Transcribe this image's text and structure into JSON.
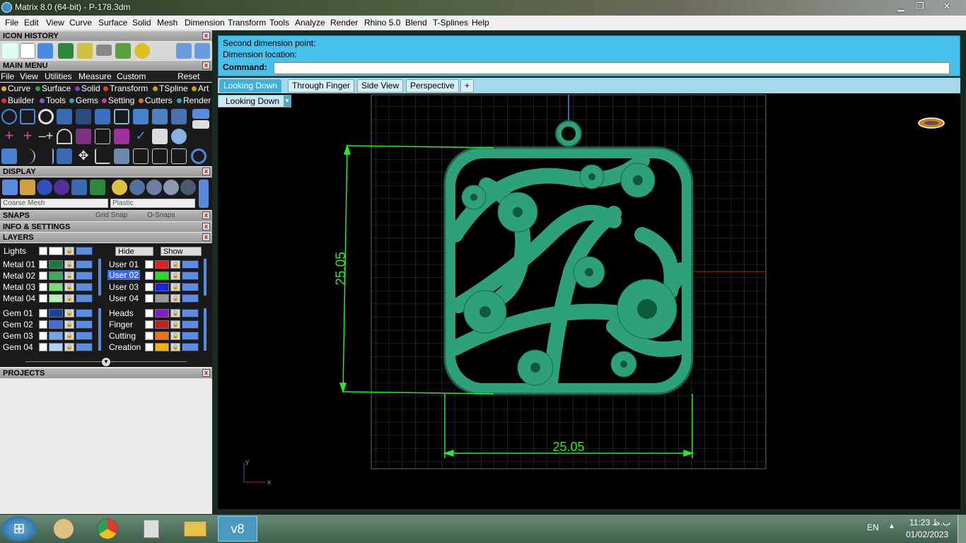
{
  "window": {
    "title": "Matrix 8.0 (64-bit) - P-178.3dm",
    "minimize": "▁",
    "restore": "❐",
    "close": "✕"
  },
  "menubar": [
    "File",
    "Edit",
    "View",
    "Curve",
    "Surface",
    "Solid",
    "Mesh",
    "Dimension",
    "Transform",
    "Tools",
    "Analyze",
    "Render",
    "Rhino 5.0",
    "Blend",
    "T-Splines",
    "Help"
  ],
  "panels": {
    "icon_history": "ICON HISTORY",
    "main_menu": "MAIN MENU",
    "display": "DISPLAY",
    "snaps": "SNAPS",
    "grid_snap": "Grid Snap",
    "o_snaps": "O-Snaps",
    "info": "INFO & SETTINGS",
    "layers": "LAYERS",
    "projects": "PROJECTS"
  },
  "main_menu": {
    "items": [
      "File",
      "View",
      "Utilities",
      "Measure",
      "Custom"
    ],
    "reset": "Reset",
    "row1": [
      {
        "label": "Curve",
        "color": "#d8b020"
      },
      {
        "label": "Surface",
        "color": "#30a040"
      },
      {
        "label": "Solid",
        "color": "#8040c0"
      },
      {
        "label": "Transform",
        "color": "#e04020"
      },
      {
        "label": "TSpline",
        "color": "#d0a000"
      },
      {
        "label": "Art",
        "color": "#d0a000"
      }
    ],
    "row2": [
      {
        "label": "Builder",
        "color": "#e03030"
      },
      {
        "label": "Tools",
        "color": "#8060d0"
      },
      {
        "label": "Gems",
        "color": "#30a0c0"
      },
      {
        "label": "Setting",
        "color": "#c04090"
      },
      {
        "label": "Cutters",
        "color": "#e07020"
      },
      {
        "label": "Render",
        "color": "#30a0c0"
      }
    ]
  },
  "display": {
    "mesh": "Coarse Mesh",
    "material": "Plastic"
  },
  "layers": {
    "lights": "Lights",
    "hide": "Hide",
    "show": "Show",
    "left": [
      {
        "name": "Metal 01",
        "color": "#1a7a40"
      },
      {
        "name": "Metal 02",
        "color": "#36b060"
      },
      {
        "name": "Metal 03",
        "color": "#70e070"
      },
      {
        "name": "Metal 04",
        "color": "#b8f0b8"
      },
      {
        "name": "Gem 01",
        "color": "#1a40a0"
      },
      {
        "name": "Gem 02",
        "color": "#3a70d8"
      },
      {
        "name": "Gem 03",
        "color": "#70a8f0"
      },
      {
        "name": "Gem 04",
        "color": "#b0d0f8"
      }
    ],
    "right": [
      {
        "name": "User 01",
        "color": "#e02020"
      },
      {
        "name": "User 02",
        "color": "#20e020"
      },
      {
        "name": "User 03",
        "color": "#2020e0"
      },
      {
        "name": "User 04",
        "color": "#9a9a9a"
      },
      {
        "name": "Heads",
        "color": "#8020c0"
      },
      {
        "name": "Finger",
        "color": "#c02020"
      },
      {
        "name": "Cutting",
        "color": "#f07010"
      },
      {
        "name": "Creation",
        "color": "#f0b010"
      }
    ]
  },
  "command": {
    "line1": "Second dimension point:",
    "line2": "Dimension location:",
    "label": "Command:"
  },
  "tabs": [
    "Looking Down",
    "Through Finger",
    "Side View",
    "Perspective",
    "+"
  ],
  "viewport": {
    "name": "Looking Down",
    "dim_v": "25.05",
    "dim_h": "25.05",
    "axis_x": "x",
    "axis_y": "y"
  },
  "taskbar": {
    "lang": "EN",
    "time": "11:23 ب.ظ",
    "date": "01/02/2023",
    "start": "⊞",
    "v8": "v8"
  }
}
